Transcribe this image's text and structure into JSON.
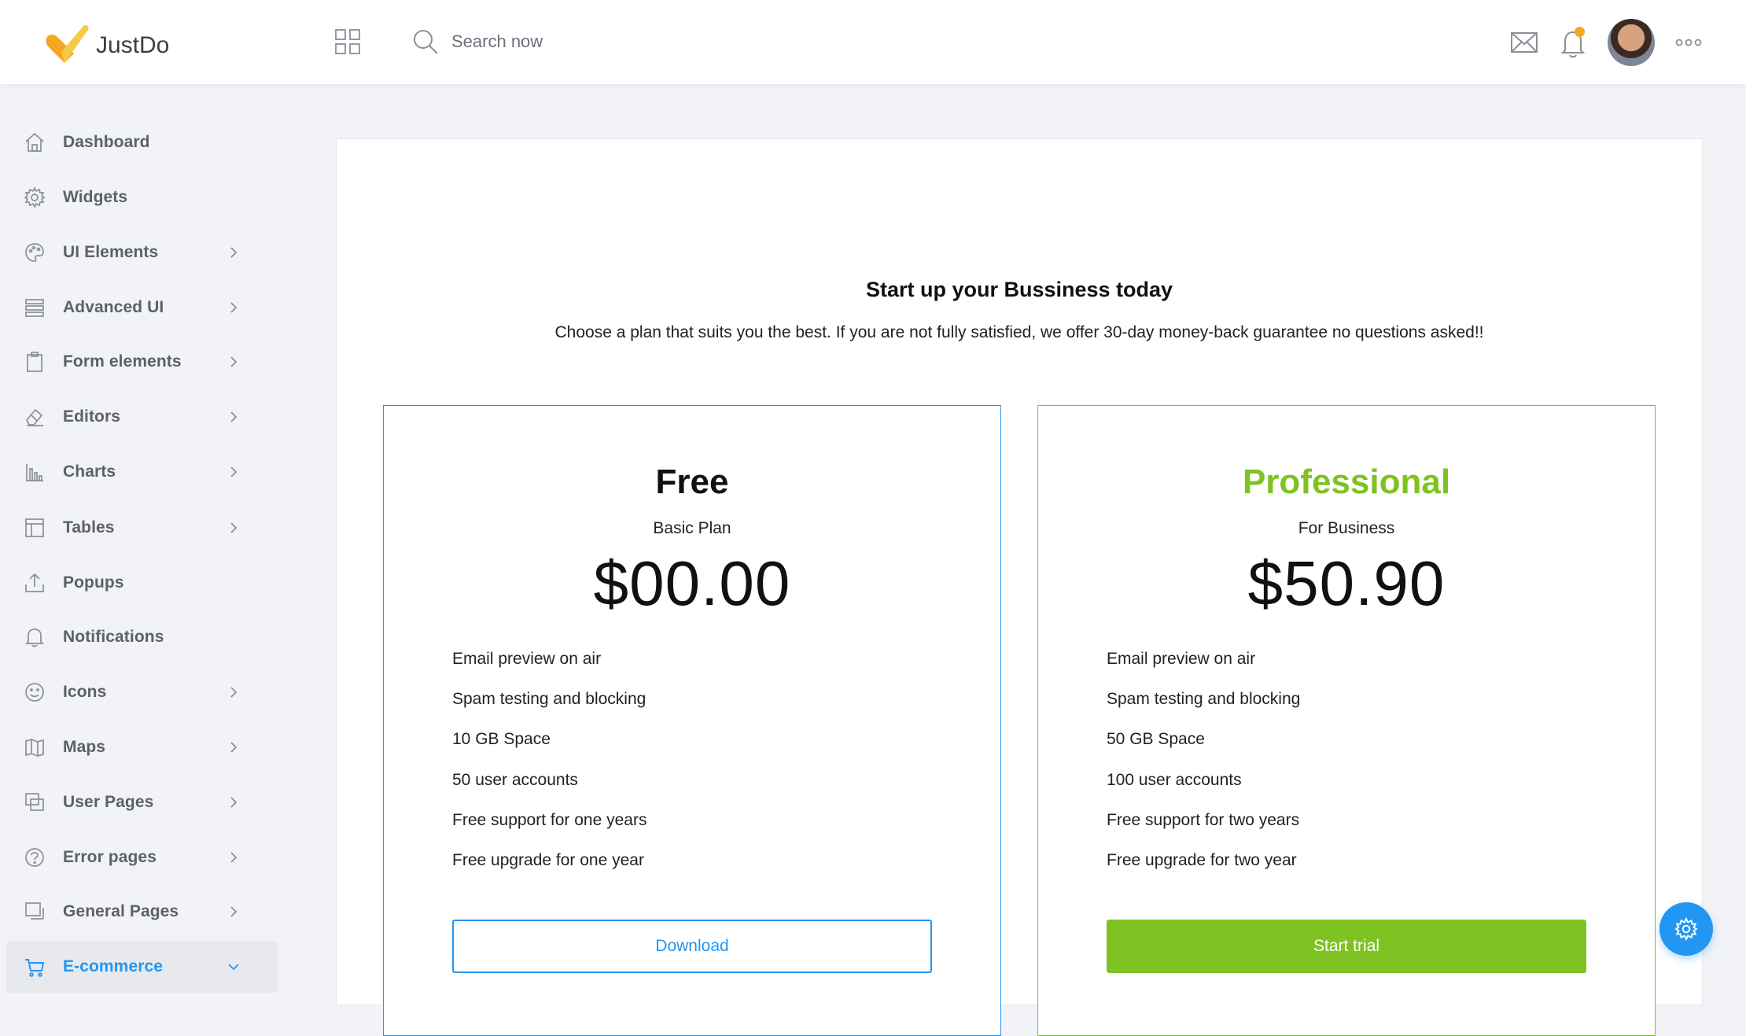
{
  "app": {
    "name": "JustDo",
    "brand_colors": {
      "accent_blue": "#2196f3",
      "accent_green": "#7ec321",
      "logo_orange": "#f5a623"
    }
  },
  "header": {
    "search_placeholder": "Search now",
    "icons": [
      "apps-grid-icon",
      "search-icon",
      "mail-icon",
      "bell-icon",
      "avatar",
      "more-icon"
    ],
    "has_notification": true
  },
  "sidebar": {
    "items": [
      {
        "label": "Dashboard",
        "icon": "home-icon",
        "has_children": false
      },
      {
        "label": "Widgets",
        "icon": "gear-icon",
        "has_children": false
      },
      {
        "label": "UI Elements",
        "icon": "palette-icon",
        "has_children": true
      },
      {
        "label": "Advanced UI",
        "icon": "layers-icon",
        "has_children": true
      },
      {
        "label": "Form elements",
        "icon": "clipboard-icon",
        "has_children": true
      },
      {
        "label": "Editors",
        "icon": "eraser-icon",
        "has_children": true
      },
      {
        "label": "Charts",
        "icon": "bar-chart-icon",
        "has_children": true
      },
      {
        "label": "Tables",
        "icon": "table-icon",
        "has_children": true
      },
      {
        "label": "Popups",
        "icon": "upload-icon",
        "has_children": false
      },
      {
        "label": "Notifications",
        "icon": "bell-icon",
        "has_children": false
      },
      {
        "label": "Icons",
        "icon": "smiley-icon",
        "has_children": true
      },
      {
        "label": "Maps",
        "icon": "map-icon",
        "has_children": true
      },
      {
        "label": "User Pages",
        "icon": "pages-icon",
        "has_children": true
      },
      {
        "label": "Error pages",
        "icon": "question-circle-icon",
        "has_children": true
      },
      {
        "label": "General Pages",
        "icon": "pages-icon",
        "has_children": true
      },
      {
        "label": "E-commerce",
        "icon": "cart-icon",
        "has_children": true,
        "active": true
      }
    ]
  },
  "main": {
    "headline": "Start up your Bussiness today",
    "subline": "Choose a plan that suits you the best. If you are not fully satisfied, we offer 30-day money-back guarantee no questions asked!!",
    "plans": [
      {
        "name": "Free",
        "tagline": "Basic Plan",
        "price": "$00.00",
        "features": [
          "Email preview on air",
          "Spam testing and blocking",
          "10 GB Space",
          "50 user accounts",
          "Free support for one years",
          "Free upgrade for one year"
        ],
        "button": "Download"
      },
      {
        "name": "Professional",
        "tagline": "For Business",
        "price": "$50.90",
        "features": [
          "Email preview on air",
          "Spam testing and blocking",
          "50 GB Space",
          "100 user accounts",
          "Free support for two years",
          "Free upgrade for two year"
        ],
        "button": "Start trial"
      }
    ]
  },
  "fab": {
    "icon": "settings-gear-icon"
  }
}
